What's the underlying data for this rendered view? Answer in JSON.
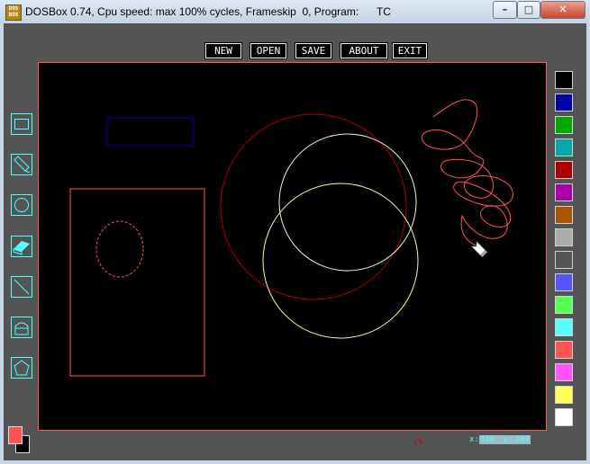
{
  "window": {
    "title": "DOSBox 0.74, Cpu speed: max 100% cycles, Frameskip  0, Program:      TC",
    "icon_text": "DOS BOX",
    "buttons": {
      "minimize": "–",
      "maximize": "□",
      "close": "✕"
    }
  },
  "menu": [
    {
      "label": "NEW"
    },
    {
      "label": "OPEN"
    },
    {
      "label": "SAVE"
    },
    {
      "label": "ABOUT"
    },
    {
      "label": "EXIT"
    }
  ],
  "tools": [
    {
      "name": "rectangle-tool",
      "icon": "rectangle-icon"
    },
    {
      "name": "pencil-tool",
      "icon": "pencil-icon"
    },
    {
      "name": "circle-tool",
      "icon": "circle-icon"
    },
    {
      "name": "eraser-tool",
      "icon": "eraser-icon"
    },
    {
      "name": "line-tool",
      "icon": "line-icon"
    },
    {
      "name": "fill-tool",
      "icon": "bucket-icon"
    },
    {
      "name": "polygon-tool",
      "icon": "pentagon-icon"
    }
  ],
  "palette": [
    "#000000",
    "#0000aa",
    "#00aa00",
    "#00aaaa",
    "#aa0000",
    "#aa00aa",
    "#aa5500",
    "#aaaaaa",
    "#555555",
    "#5555ff",
    "#55ff55",
    "#55ffff",
    "#ff5555",
    "#ff55ff",
    "#ffff55",
    "#ffffff"
  ],
  "current_colors": {
    "foreground": "#ff5555",
    "background": "#000000"
  },
  "status": {
    "ck": "ck",
    "x_label": "x:",
    "x_value": "486",
    "y_label": "y:",
    "y_value": "204"
  }
}
